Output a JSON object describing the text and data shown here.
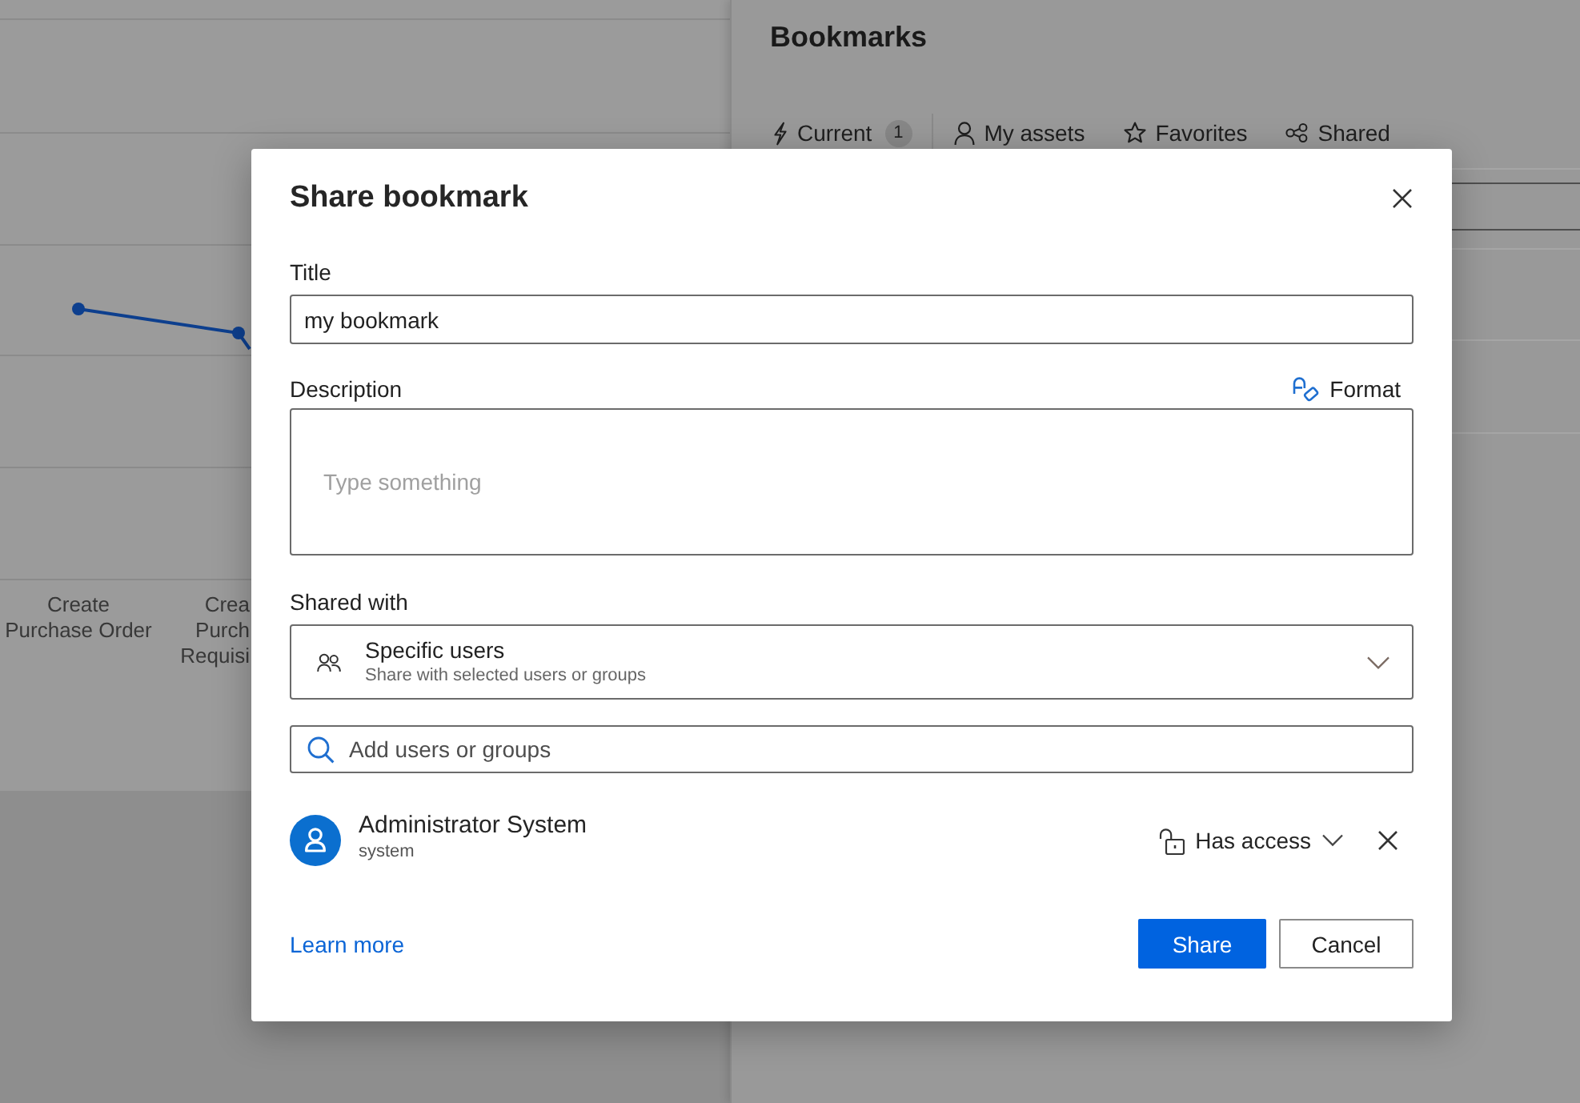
{
  "report_chart": {
    "x_labels": [
      {
        "lines": [
          "Create",
          "Purchase Order"
        ]
      },
      {
        "lines": [
          "Crea",
          "Purch",
          "Requisi"
        ]
      }
    ]
  },
  "bookmarks_panel": {
    "title": "Bookmarks",
    "tabs": [
      {
        "label": "Current",
        "count": "1"
      },
      {
        "label": "My assets"
      },
      {
        "label": "Favorites"
      },
      {
        "label": "Shared"
      }
    ]
  },
  "share_dialog": {
    "title": "Share bookmark",
    "title_field": {
      "label": "Title",
      "value": "my bookmark"
    },
    "description_field": {
      "label": "Description",
      "format_button": "Format",
      "placeholder": "Type something"
    },
    "shared_with": {
      "label": "Shared with",
      "option": "Specific users",
      "option_description": "Share with selected users or groups"
    },
    "user_search": {
      "placeholder": "Add users or groups"
    },
    "members": [
      {
        "name": "Administrator System",
        "username": "system",
        "access": "Has access"
      }
    ],
    "learn_more_link": "Learn more",
    "buttons": [
      {
        "label": "Share",
        "kind": "primary"
      },
      {
        "label": "Cancel",
        "kind": "secondary"
      }
    ]
  }
}
